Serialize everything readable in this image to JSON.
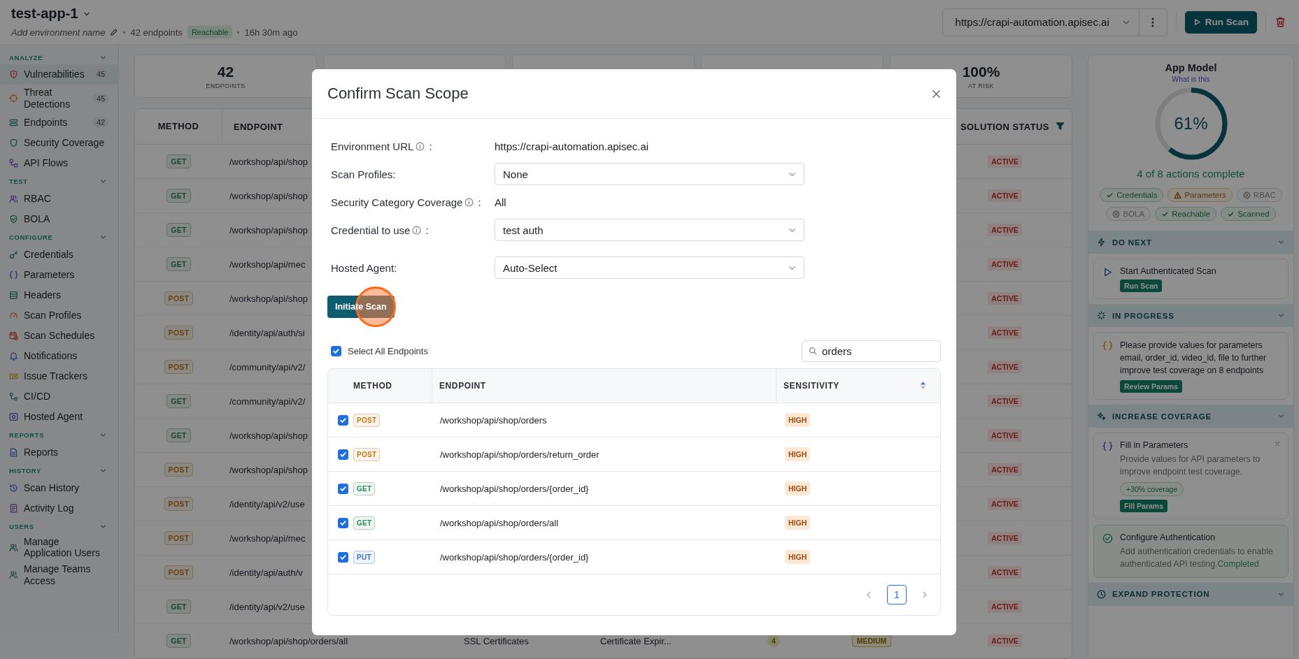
{
  "header": {
    "title": "test-app-1",
    "env_prompt": "Add environment name",
    "endpoints": "42 endpoints",
    "status_badge": "Reachable",
    "last_scan": "16h 30m ago",
    "url_select": "https://crapi-automation.apisec.ai",
    "run_button": "Run Scan"
  },
  "sidebar": {
    "sections": [
      {
        "title": "ANALYZE",
        "expanded": true,
        "items": [
          {
            "label": "Vulnerabilities",
            "count": "45",
            "selected": true
          },
          {
            "label": "Threat Detections",
            "count": "45",
            "selected": false
          },
          {
            "label": "Endpoints",
            "count": "42",
            "selected": false
          },
          {
            "label": "Security Coverage",
            "selected": false
          },
          {
            "label": "API Flows",
            "selected": false
          }
        ]
      },
      {
        "title": "TEST",
        "expanded": true,
        "items": [
          {
            "label": "RBAC",
            "selected": false
          },
          {
            "label": "BOLA",
            "selected": false
          }
        ]
      },
      {
        "title": "CONFIGURE",
        "expanded": true,
        "items": [
          {
            "label": "Credentials",
            "selected": false
          },
          {
            "label": "Parameters",
            "selected": false
          },
          {
            "label": "Headers",
            "selected": false
          },
          {
            "label": "Scan Profiles",
            "selected": false
          },
          {
            "label": "Scan Schedules",
            "selected": false
          },
          {
            "label": "Notifications",
            "selected": false
          },
          {
            "label": "Issue Trackers",
            "selected": false
          },
          {
            "label": "CI/CD",
            "selected": false
          },
          {
            "label": "Hosted Agent",
            "selected": false
          }
        ]
      },
      {
        "title": "REPORTS",
        "expanded": true,
        "items": [
          {
            "label": "Reports",
            "selected": false
          }
        ]
      },
      {
        "title": "HISTORY",
        "expanded": true,
        "items": [
          {
            "label": "Scan History",
            "selected": false
          },
          {
            "label": "Activity Log",
            "selected": false
          }
        ]
      },
      {
        "title": "USERS",
        "expanded": true,
        "items": [
          {
            "label": "Manage Application Users",
            "selected": false
          },
          {
            "label": "Manage Teams Access",
            "selected": false
          }
        ]
      }
    ]
  },
  "stats": [
    {
      "value": "42",
      "label": "ENDPOINTS"
    },
    {
      "value": "100%",
      "label": "AT RISK"
    }
  ],
  "background_table": {
    "columns": [
      "METHOD",
      "ENDPOINT",
      "SOLUTION STATUS"
    ],
    "rows": [
      {
        "method": "GET",
        "kind": "read",
        "endpoint": "/workshop/api/shop",
        "status": "ACTIVE"
      },
      {
        "method": "GET",
        "kind": "read",
        "endpoint": "/workshop/api/shop",
        "status": "ACTIVE"
      },
      {
        "method": "GET",
        "kind": "read",
        "endpoint": "/workshop/api/shop",
        "status": "ACTIVE"
      },
      {
        "method": "GET",
        "kind": "read",
        "endpoint": "/workshop/api/mec",
        "status": "ACTIVE"
      },
      {
        "method": "POST",
        "kind": "write",
        "endpoint": "/workshop/api/shop",
        "status": "ACTIVE"
      },
      {
        "method": "POST",
        "kind": "write",
        "endpoint": "/identity/api/auth/si",
        "status": "ACTIVE"
      },
      {
        "method": "POST",
        "kind": "write",
        "endpoint": "/community/api/v2/",
        "status": "ACTIVE"
      },
      {
        "method": "GET",
        "kind": "read",
        "endpoint": "/community/api/v2/",
        "status": "ACTIVE"
      },
      {
        "method": "GET",
        "kind": "read",
        "endpoint": "/workshop/api/shop",
        "status": "ACTIVE"
      },
      {
        "method": "POST",
        "kind": "write",
        "endpoint": "/workshop/api/shop",
        "status": "ACTIVE"
      },
      {
        "method": "POST",
        "kind": "write",
        "endpoint": "/identity/api/v2/use",
        "status": "ACTIVE"
      },
      {
        "method": "POST",
        "kind": "write",
        "endpoint": "/workshop/api/mec",
        "status": "ACTIVE"
      },
      {
        "method": "POST",
        "kind": "write",
        "endpoint": "/identity/api/auth/v",
        "status": "ACTIVE"
      },
      {
        "method": "GET",
        "kind": "read",
        "endpoint": "/identity/api/v2/use",
        "status": "ACTIVE"
      },
      {
        "method": "GET",
        "kind": "read",
        "endpoint": "/workshop/api/shop/orders/all",
        "category": "SSL Certificates",
        "title": "Certificate Expir...",
        "count": "4",
        "severity": "MEDIUM",
        "status": "ACTIVE"
      }
    ]
  },
  "app_model": {
    "title": "App Model",
    "help_link": "What is this",
    "level": 0.61,
    "percent": "61%",
    "summary": "4 of 8 actions complete",
    "chips": [
      {
        "label": "Credentials",
        "kind": "done"
      },
      {
        "label": "Parameters",
        "kind": "warning"
      },
      {
        "label": "RBAC",
        "kind": "missing"
      },
      {
        "label": "BOLA",
        "kind": "missing"
      },
      {
        "label": "Reachable",
        "kind": "done"
      },
      {
        "label": "Scanned",
        "kind": "done"
      }
    ],
    "sections": [
      {
        "title": "DO NEXT",
        "expanded": true,
        "cards": [
          {
            "kind": "action",
            "title": "Start Authenticated Scan",
            "button": "Run Scan"
          }
        ]
      },
      {
        "title": "IN PROGRESS",
        "expanded": true,
        "cards": [
          {
            "kind": "progress",
            "text": "Please provide values for parameters email, order_id, video_id, file to further improve test coverage on 8 endpoints",
            "button": "Review Params"
          }
        ]
      },
      {
        "title": "INCREASE COVERAGE",
        "expanded": true,
        "cards": [
          {
            "kind": "suggestion",
            "title": "Fill in Parameters",
            "text": "Provide values for API parameters to improve endpoint test coverage.",
            "tag": "+30% coverage",
            "button": "Fill Params"
          },
          {
            "kind": "completed",
            "title": "Configure Authentication",
            "text": "Add authentication credentials to enable authenticated API testing.",
            "status": "Completed"
          }
        ]
      },
      {
        "title": "EXPAND PROTECTION",
        "expanded": true
      }
    ]
  },
  "modal": {
    "title": "Confirm Scan Scope",
    "fields": [
      {
        "kind": "text",
        "label": "Environment URL",
        "info": true,
        "suffix": ":",
        "value": "https://crapi-automation.apisec.ai"
      },
      {
        "kind": "select",
        "label": "Scan Profiles:",
        "info": false,
        "value": "None"
      },
      {
        "kind": "text",
        "label": "Security Category Coverage",
        "info": true,
        "suffix": ":",
        "value": "All"
      },
      {
        "kind": "select",
        "label": "Credential to use",
        "info": true,
        "suffix": ":",
        "value": "test auth"
      },
      {
        "kind": "select",
        "label": "Hosted Agent:",
        "info": false,
        "value": "Auto-Select"
      }
    ],
    "initiate_button": "Initiate Scan",
    "select_all": {
      "label": "Select All Endpoints",
      "checked": true
    },
    "search": {
      "value": "orders"
    },
    "table": {
      "columns": [
        "METHOD",
        "ENDPOINT",
        "SENSITIVITY"
      ],
      "rows": [
        {
          "checked": true,
          "method": "POST",
          "color": "#c07a17",
          "endpoint": "/workshop/api/shop/orders",
          "sensitivity": "HIGH"
        },
        {
          "checked": true,
          "method": "POST",
          "color": "#c07a17",
          "endpoint": "/workshop/api/shop/orders/return_order",
          "sensitivity": "HIGH"
        },
        {
          "checked": true,
          "method": "GET",
          "color": "#2f8a56",
          "endpoint": "/workshop/api/shop/orders/{order_id}",
          "sensitivity": "HIGH"
        },
        {
          "checked": true,
          "method": "GET",
          "color": "#2f8a56",
          "endpoint": "/workshop/api/shop/orders/all",
          "sensitivity": "HIGH"
        },
        {
          "checked": true,
          "method": "PUT",
          "color": "#3b6fd4",
          "endpoint": "/workshop/api/shop/orders/{order_id}",
          "sensitivity": "HIGH"
        }
      ]
    },
    "pagination": {
      "pages": [
        {
          "label": "1",
          "selected": true
        }
      ]
    }
  }
}
